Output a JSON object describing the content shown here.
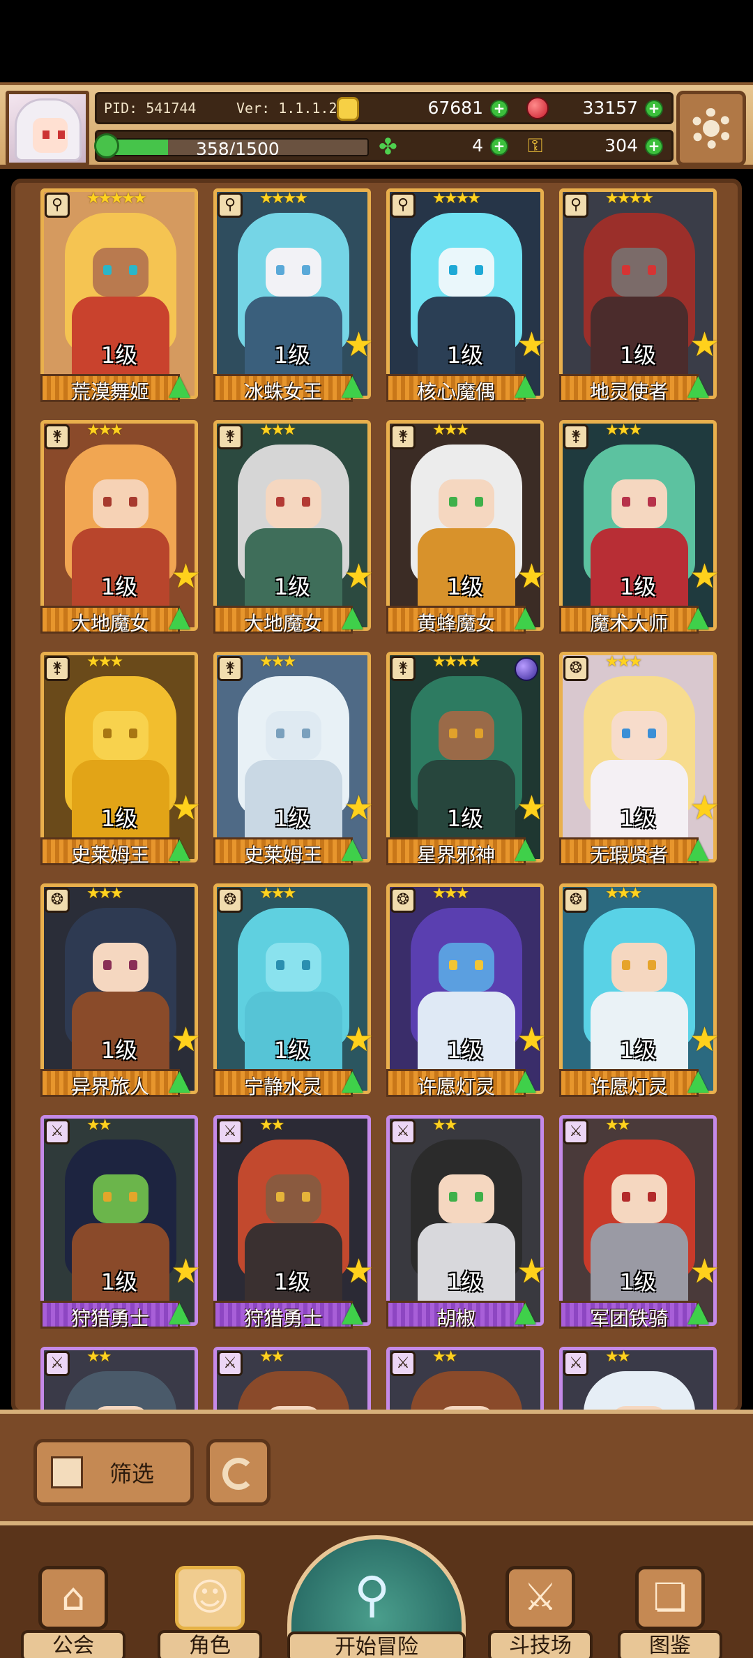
{
  "header": {
    "pid": "PID: 541744",
    "version": "Ver: 1.1.1.2",
    "gold": "67681",
    "gems": "33157",
    "xp_text": "358/1500",
    "xp_fraction": 0.239,
    "clover_count": "4",
    "key_count": "304"
  },
  "characters": [
    {
      "name": "荒漠舞姬",
      "level": "1级",
      "stars": "★★★★★",
      "rarity": "gold",
      "type_icon": "staff-icon",
      "hair": "#f5c452",
      "skin": "#b97a4f",
      "eye": "#2bb6c8",
      "body": "#c9422d",
      "bg": "#d59a5f",
      "big_star": false
    },
    {
      "name": "冰蛛女王",
      "level": "1级",
      "stars": "★★★★",
      "rarity": "gold",
      "type_icon": "staff-icon",
      "hair": "#75d5e6",
      "skin": "#f2f2f6",
      "eye": "#5aa9d8",
      "body": "#3a5f7c",
      "bg": "#2f4d5e",
      "big_star": true
    },
    {
      "name": "核心魔偶",
      "level": "1级",
      "stars": "★★★★",
      "rarity": "gold",
      "type_icon": "staff-icon",
      "hair": "#6fe1f2",
      "skin": "#eaf7fb",
      "eye": "#1ea9d6",
      "body": "#2b3f55",
      "bg": "#263548",
      "big_star": true
    },
    {
      "name": "地灵使者",
      "level": "1级",
      "stars": "★★★★",
      "rarity": "gold",
      "type_icon": "staff-icon",
      "hair": "#9b2f2a",
      "skin": "#7b6b69",
      "eye": "#d53434",
      "body": "#4b2c2c",
      "bg": "#3a3d48",
      "big_star": true
    },
    {
      "name": "大地魔女",
      "level": "1级",
      "stars": "★★★",
      "rarity": "gold",
      "type_icon": "wand-icon",
      "hair": "#f1a652",
      "skin": "#f6d2b5",
      "eye": "#a73a2e",
      "body": "#b8452c",
      "bg": "#8a4a2a",
      "big_star": true
    },
    {
      "name": "大地魔女",
      "level": "1级",
      "stars": "★★★",
      "rarity": "gold",
      "type_icon": "wand-icon",
      "hair": "#d6d6d6",
      "skin": "#f5d7c0",
      "eye": "#b33a34",
      "body": "#3f6e5a",
      "bg": "#2c4a40",
      "big_star": true
    },
    {
      "name": "黄蜂魔女",
      "level": "1级",
      "stars": "★★★",
      "rarity": "gold",
      "type_icon": "wand-icon",
      "hair": "#ececec",
      "skin": "#f5d7c0",
      "eye": "#3fb04a",
      "body": "#d8922b",
      "bg": "#3b2c25",
      "big_star": true
    },
    {
      "name": "魔术大师",
      "level": "1级",
      "stars": "★★★",
      "rarity": "gold",
      "type_icon": "wand-icon",
      "hair": "#5cc2a0",
      "skin": "#f5d7c0",
      "eye": "#b7324a",
      "body": "#b82e35",
      "bg": "#1f3a3e",
      "big_star": true
    },
    {
      "name": "史莱姆王",
      "level": "1级",
      "stars": "★★★",
      "rarity": "gold",
      "type_icon": "wand-icon",
      "hair": "#f2be2e",
      "skin": "#f8d24d",
      "eye": "#a87612",
      "body": "#e2a417",
      "bg": "#6a4a1a",
      "big_star": true
    },
    {
      "name": "史莱姆王",
      "level": "1级",
      "stars": "★★★",
      "rarity": "gold",
      "type_icon": "wand-icon",
      "hair": "#e8f1f6",
      "skin": "#dfeaf2",
      "eye": "#7aa0bd",
      "body": "#c9d8e4",
      "bg": "#4f6a86",
      "big_star": true
    },
    {
      "name": "星界邪神",
      "level": "1级",
      "stars": "★★★★",
      "rarity": "gold",
      "type_icon": "wand-icon",
      "hair": "#2d7b61",
      "skin": "#9a6a48",
      "eye": "#e0a12b",
      "body": "#27463d",
      "bg": "#1f3731",
      "big_star": true,
      "orb": true
    },
    {
      "name": "无瑕贤者",
      "level": "1级",
      "stars": "★★★",
      "rarity": "gold",
      "type_icon": "orb-icon",
      "hair": "#f7dc8e",
      "skin": "#f7dccb",
      "eye": "#3b8fd6",
      "body": "#f4f0f4",
      "bg": "#d9c8cf",
      "big_star": true
    },
    {
      "name": "异界旅人",
      "level": "1级",
      "stars": "★★★",
      "rarity": "gold",
      "type_icon": "orb-icon",
      "hair": "#2e3a52",
      "skin": "#f5d7c0",
      "eye": "#8a2f56",
      "body": "#8a4b2a",
      "bg": "#2a2d38",
      "big_star": true
    },
    {
      "name": "宁静水灵",
      "level": "1级",
      "stars": "★★★",
      "rarity": "gold",
      "type_icon": "orb-icon",
      "hair": "#5fd0e0",
      "skin": "#8ae2ee",
      "eye": "#2a8fb0",
      "body": "#56c4d6",
      "bg": "#2b5660",
      "big_star": true
    },
    {
      "name": "许愿灯灵",
      "level": "1级",
      "stars": "★★★",
      "rarity": "gold",
      "type_icon": "orb-icon",
      "hair": "#5a3fb0",
      "skin": "#5b9fe0",
      "eye": "#f2c534",
      "body": "#dfe9f5",
      "bg": "#3a2d6a",
      "big_star": true
    },
    {
      "name": "许愿灯灵",
      "level": "1级",
      "stars": "★★★",
      "rarity": "gold",
      "type_icon": "orb-icon",
      "hair": "#59d2e6",
      "skin": "#f5d7c0",
      "eye": "#e6a42b",
      "body": "#eaf2f6",
      "bg": "#2b6a80",
      "big_star": true
    },
    {
      "name": "狩猎勇士",
      "level": "1级",
      "stars": "★★",
      "rarity": "purple",
      "type_icon": "sword-icon",
      "hair": "#1d2440",
      "skin": "#6bb54b",
      "eye": "#e3a62a",
      "body": "#8a4a2a",
      "bg": "#2f3a3a",
      "big_star": true
    },
    {
      "name": "狩猎勇士",
      "level": "1级",
      "stars": "★★",
      "rarity": "purple",
      "type_icon": "sword-icon",
      "hair": "#c2492e",
      "skin": "#8a5a3f",
      "eye": "#e6b43a",
      "body": "#3a3030",
      "bg": "#2b2a35",
      "big_star": true
    },
    {
      "name": "胡椒",
      "level": "1级",
      "stars": "★★",
      "rarity": "purple",
      "type_icon": "sword-icon",
      "hair": "#2b2b2b",
      "skin": "#f5d7c0",
      "eye": "#3fb04a",
      "body": "#d8d8dc",
      "bg": "#39393f",
      "big_star": true
    },
    {
      "name": "军团铁骑",
      "level": "1级",
      "stars": "★★",
      "rarity": "purple",
      "type_icon": "sword-icon",
      "hair": "#c83a2a",
      "skin": "#f5d7c0",
      "eye": "#b32a2a",
      "body": "#9a9aa4",
      "bg": "#4a3a3a",
      "big_star": true
    },
    {
      "name": "",
      "level": "",
      "stars": "★★",
      "rarity": "purple",
      "type_icon": "sword-icon",
      "hair": "#4a5a6a",
      "skin": "#f5d7c0",
      "eye": "#333",
      "body": "#555",
      "bg": "#3a3a48",
      "big_star": false
    },
    {
      "name": "",
      "level": "",
      "stars": "★★",
      "rarity": "purple",
      "type_icon": "sword-icon",
      "hair": "#8a4a2a",
      "skin": "#f5d7c0",
      "eye": "#333",
      "body": "#f4f4f4",
      "bg": "#3a3a48",
      "big_star": false
    },
    {
      "name": "",
      "level": "",
      "stars": "★★",
      "rarity": "purple",
      "type_icon": "sword-icon",
      "hair": "#8a4a2a",
      "skin": "#f5d7c0",
      "eye": "#333",
      "body": "#555",
      "bg": "#3a3a48",
      "big_star": false
    },
    {
      "name": "",
      "level": "",
      "stars": "★★",
      "rarity": "purple",
      "type_icon": "sword-icon",
      "hair": "#e6eef6",
      "skin": "#f5d7c0",
      "eye": "#333",
      "body": "#d8d8dc",
      "bg": "#3a3a48",
      "big_star": false
    }
  ],
  "filter": {
    "label": "筛选"
  },
  "nav": {
    "guild": "公会",
    "character": "角色",
    "adventure": "开始冒险",
    "arena": "斗技场",
    "codex": "图鉴"
  }
}
